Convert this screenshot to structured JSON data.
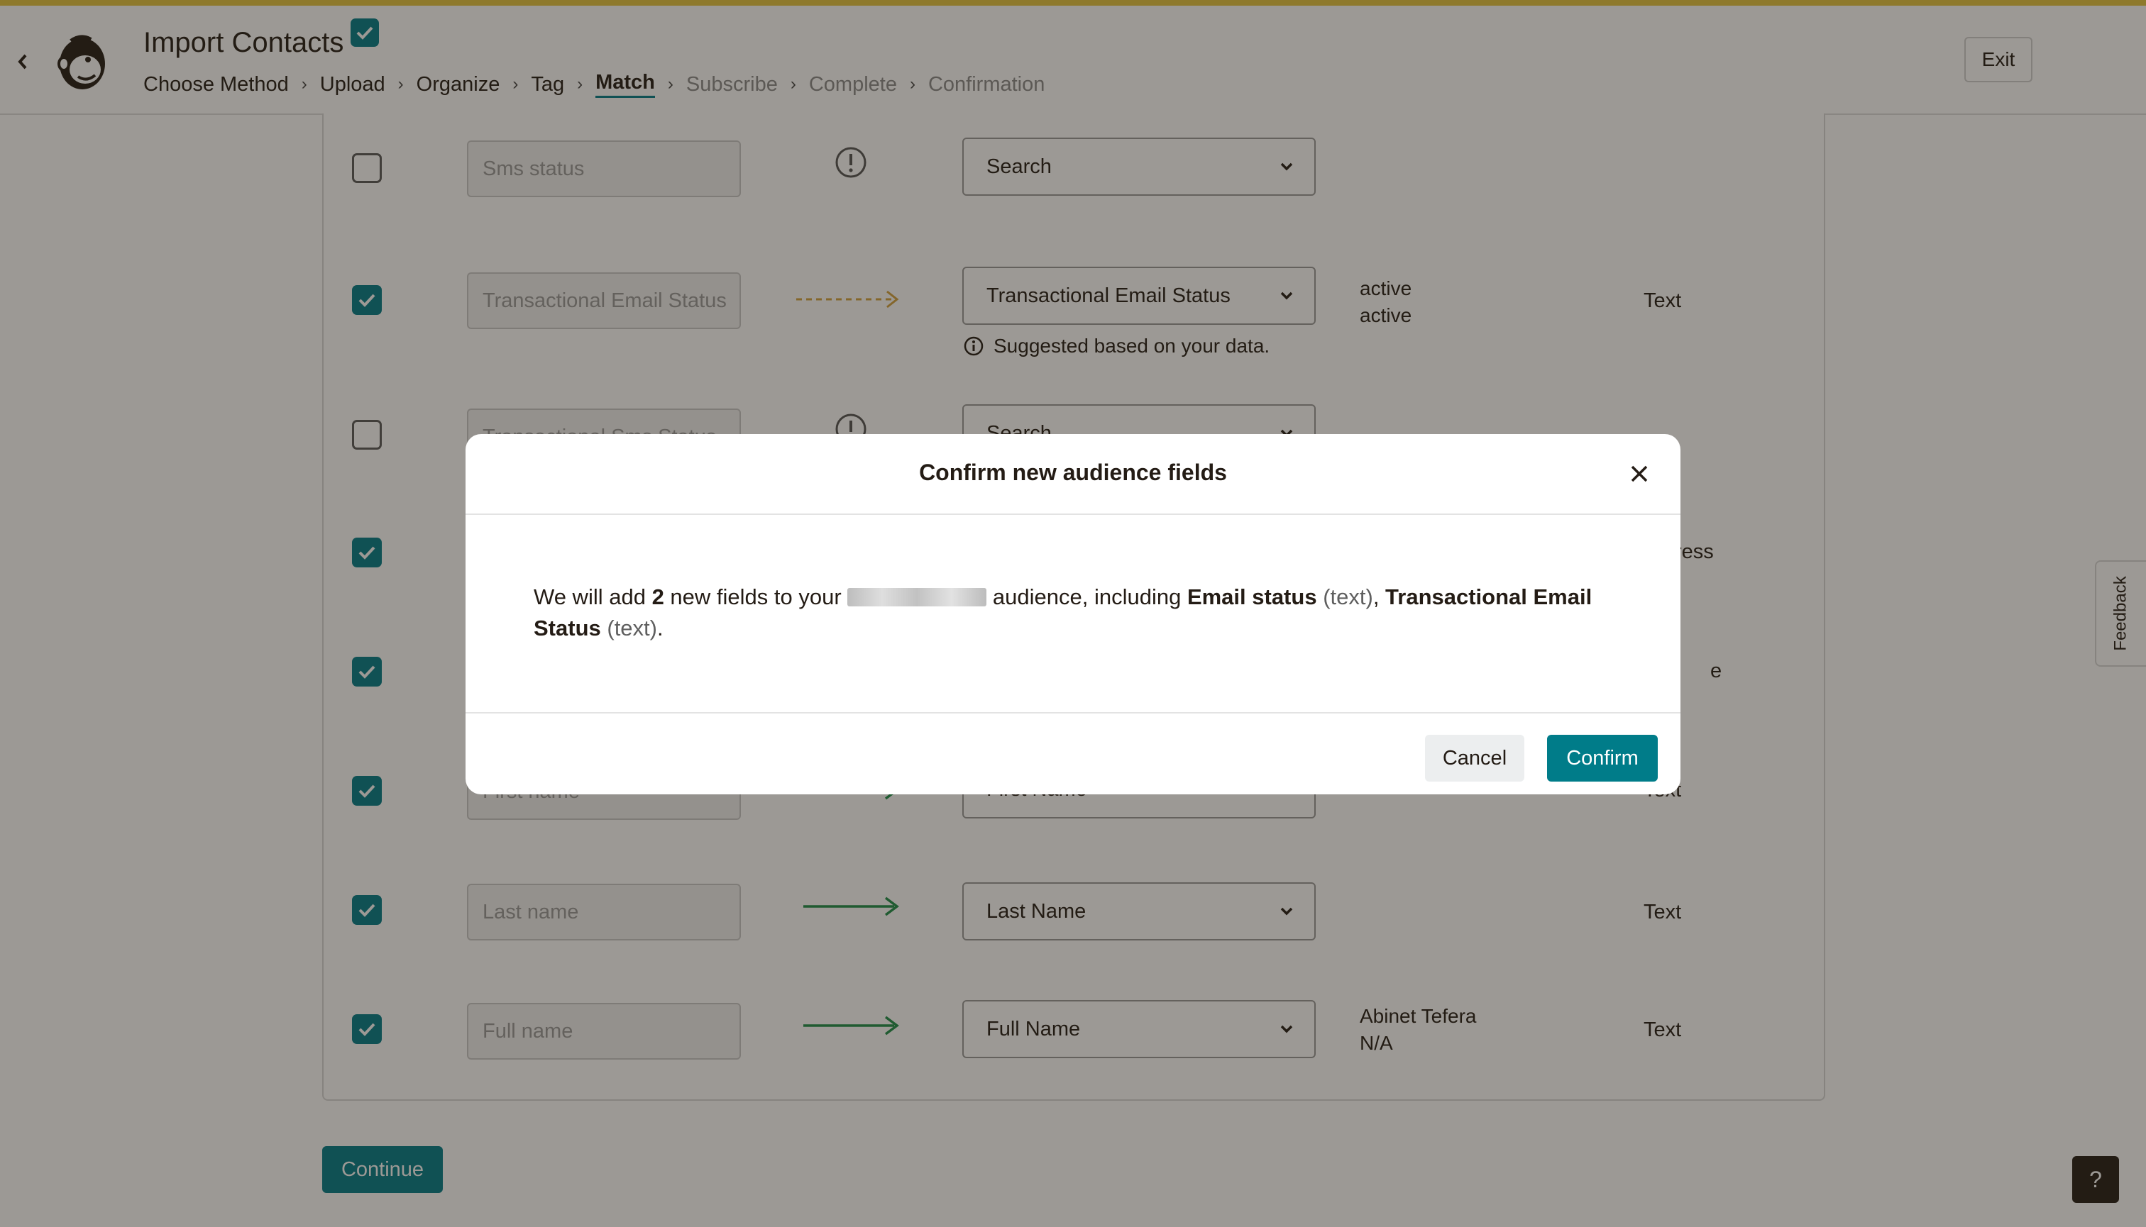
{
  "header": {
    "back_icon": "chevron-left-icon",
    "logo_icon": "mailchimp-freddie-logo",
    "title": "Import Contacts",
    "breadcrumb": [
      "Choose Method",
      "Upload",
      "Organize",
      "Tag",
      "Match",
      "Subscribe",
      "Complete",
      "Confirmation"
    ],
    "breadcrumb_current": "Match",
    "exit_label": "Exit"
  },
  "rows": [
    {
      "checked": false,
      "source": "Sms status",
      "mapping": "warning",
      "field": "Search",
      "hint": "",
      "samples": [],
      "type": ""
    },
    {
      "checked": true,
      "source": "Transactional Email Status",
      "mapping": "suggested",
      "field": "Transactional Email Status",
      "hint": "Suggested based on your data.",
      "samples": [
        "active",
        "active"
      ],
      "type": "Text"
    },
    {
      "checked": false,
      "source": "Transactional Sms Status",
      "mapping": "warning",
      "field": "Search",
      "hint": "",
      "samples": [],
      "type": ""
    },
    {
      "checked": true,
      "source": "",
      "mapping": "matched",
      "field": "",
      "hint": "",
      "samples": [],
      "type": "ress"
    },
    {
      "checked": true,
      "source": "",
      "mapping": "matched",
      "field": "",
      "hint": "",
      "samples": [],
      "type": "e"
    },
    {
      "checked": true,
      "source": "First name",
      "mapping": "matched",
      "field": "First Name",
      "hint": "",
      "samples": [],
      "type": "Text"
    },
    {
      "checked": true,
      "source": "Last name",
      "mapping": "matched",
      "field": "Last Name",
      "hint": "",
      "samples": [],
      "type": "Text"
    },
    {
      "checked": true,
      "source": "Full name",
      "mapping": "matched",
      "field": "Full Name",
      "hint": "",
      "samples": [
        "Abinet Tefera",
        "N/A"
      ],
      "type": "Text"
    }
  ],
  "actions": {
    "continue_label": "Continue",
    "help_label": "?",
    "feedback_label": "Feedback"
  },
  "modal": {
    "title": "Confirm new audience fields",
    "body_prefix": "We will add ",
    "count": "2",
    "body_mid": " new fields to your ",
    "body_mid2": " audience, including ",
    "field1": "Email status",
    "field1_type": "(text)",
    "comma": ", ",
    "field2": "Transactional Email Status",
    "field2_type": "(text)",
    "period": ".",
    "cancel_label": "Cancel",
    "confirm_label": "Confirm"
  },
  "colors": {
    "accent": "#007c89",
    "suggested_arrow": "#d3a23f",
    "matched_arrow": "#1e8e4a",
    "top_bar": "#e5c540"
  }
}
